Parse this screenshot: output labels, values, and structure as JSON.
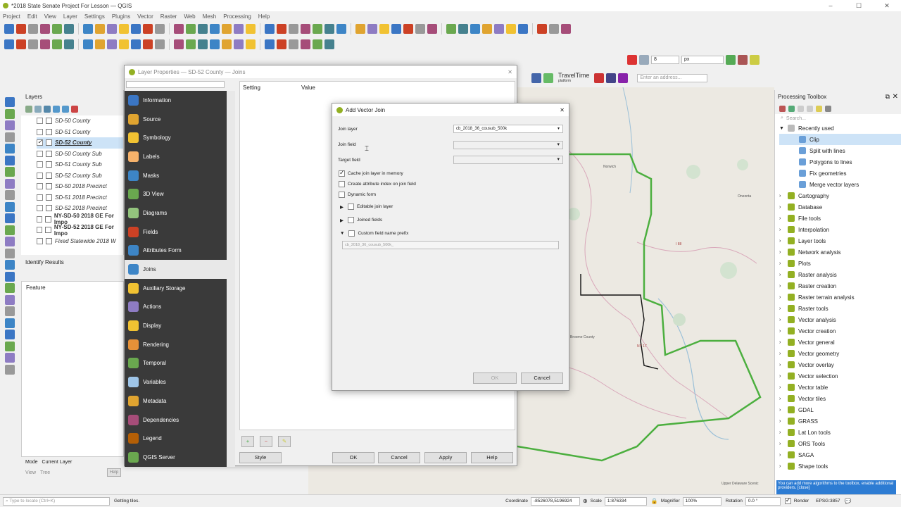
{
  "window": {
    "title": "*2018 State Senate Project For Lesson — QGIS",
    "minimize": "–",
    "maximize": "☐",
    "close": "✕"
  },
  "menu": [
    "Project",
    "Edit",
    "View",
    "Layer",
    "Settings",
    "Plugins",
    "Vector",
    "Raster",
    "Web",
    "Mesh",
    "Processing",
    "Help"
  ],
  "layers_panel": {
    "title": "Layers",
    "items": [
      {
        "label": "SD-50 County",
        "checked": false,
        "bold": false
      },
      {
        "label": "SD-51 County",
        "checked": false,
        "bold": false
      },
      {
        "label": "SD-52 County",
        "checked": true,
        "bold": false,
        "selected": true
      },
      {
        "label": "SD-50 County Sub",
        "checked": false
      },
      {
        "label": "SD-51 County Sub",
        "checked": false
      },
      {
        "label": "SD-52 County Sub",
        "checked": false
      },
      {
        "label": "SD-50 2018 Precinct",
        "checked": false
      },
      {
        "label": "SD-51 2018 Precinct",
        "checked": false
      },
      {
        "label": "SD-52 2018 Precinct",
        "checked": false
      },
      {
        "label": "NY-SD-50 2018 GE For Impo",
        "checked": false,
        "bold": true
      },
      {
        "label": "NY-SD-52 2018 GE For Impo",
        "checked": false,
        "bold": true
      },
      {
        "label": "Fixed Statewide 2018 W",
        "checked": false
      }
    ]
  },
  "identify_panel": {
    "title": "Identify Results",
    "column": "Feature",
    "mode_label": "Mode",
    "mode_value": "Current Layer",
    "view_label": "View",
    "view_value": "Tree",
    "help": "Help"
  },
  "layer_props": {
    "title": "Layer Properties — SD-52 County — Joins",
    "sidebar": [
      "Information",
      "Source",
      "Symbology",
      "Labels",
      "Masks",
      "3D View",
      "Diagrams",
      "Fields",
      "Attributes Form",
      "Joins",
      "Auxiliary Storage",
      "Actions",
      "Display",
      "Rendering",
      "Temporal",
      "Variables",
      "Metadata",
      "Dependencies",
      "Legend",
      "QGIS Server"
    ],
    "selected": "Joins",
    "col_setting": "Setting",
    "col_value": "Value",
    "style_btn": "Style",
    "ok": "OK",
    "cancel": "Cancel",
    "apply": "Apply",
    "help": "Help"
  },
  "add_join": {
    "title": "Add Vector Join",
    "join_layer_label": "Join layer",
    "join_layer_value": "cb_2018_36_cousub_500k",
    "join_field_label": "Join field",
    "target_field_label": "Target field",
    "cache": "Cache join layer in memory",
    "create_index": "Create attribute index on join field",
    "dynamic_form": "Dynamic form",
    "editable": "Editable join layer",
    "joined_fields": "Joined fields",
    "prefix": "Custom field name prefix",
    "prefix_value": "cb_2018_36_cousub_500k_",
    "ok": "OK",
    "cancel": "Cancel"
  },
  "toolbox": {
    "title": "Processing Toolbox",
    "search_placeholder": "Search...",
    "recently_used": "Recently used",
    "recent": [
      "Clip",
      "Split with lines",
      "Polygons to lines",
      "Fix geometries",
      "Merge vector layers"
    ],
    "groups": [
      "Cartography",
      "Database",
      "File tools",
      "Interpolation",
      "Layer tools",
      "Network analysis",
      "Plots",
      "Raster analysis",
      "Raster creation",
      "Raster terrain analysis",
      "Raster tools",
      "Vector analysis",
      "Vector creation",
      "Vector general",
      "Vector geometry",
      "Vector overlay",
      "Vector selection",
      "Vector table",
      "Vector tiles",
      "GDAL",
      "GRASS",
      "Lat Lon tools",
      "ORS Tools",
      "SAGA",
      "Shape tools"
    ],
    "footer_text": "You can add more algorithms to the toolbox, enable additional providers. [close]"
  },
  "map": {
    "address_placeholder": "Enter an address...",
    "travel_time": "TravelTime",
    "travel_sub": "platform",
    "search_value": "8",
    "unit": "px",
    "labels": [
      "Norwich",
      "Oneonta",
      "I 88",
      "NY 17",
      "Upper Delaware Scenic",
      "Broome County"
    ]
  },
  "status": {
    "locate_placeholder": "Type to locate (Ctrl+K)",
    "message": "Getting tiles.",
    "coordinate_label": "Coordinate",
    "coordinate_value": "-8526078,5196924",
    "scale_label": "Scale",
    "scale_value": "1:876334",
    "magnifier_label": "Magnifier",
    "magnifier_value": "100%",
    "rotation_label": "Rotation",
    "rotation_value": "0.0 °",
    "render_label": "Render",
    "epsg": "EPSG:3857"
  }
}
